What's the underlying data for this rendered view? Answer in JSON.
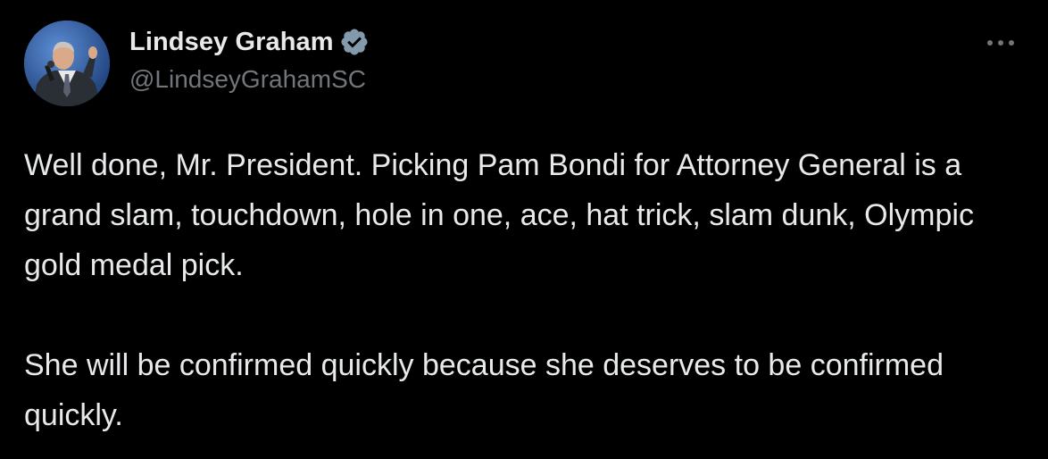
{
  "author": {
    "display_name": "Lindsey Graham",
    "handle": "@LindseyGrahamSC",
    "verified": true
  },
  "tweet": {
    "paragraphs": [
      "Well done, Mr. President. Picking Pam Bondi for Attorney General is a grand slam, touchdown, hole in one, ace, hat trick, slam dunk, Olympic gold medal pick.",
      "She will be confirmed quickly because she deserves to be confirmed quickly."
    ]
  },
  "icons": {
    "verified": "verified-badge-icon",
    "more": "more-options-icon"
  },
  "colors": {
    "background": "#000000",
    "primary_text": "#e7e9ea",
    "secondary_text": "#71767b",
    "verified_badge": "#829aab"
  }
}
